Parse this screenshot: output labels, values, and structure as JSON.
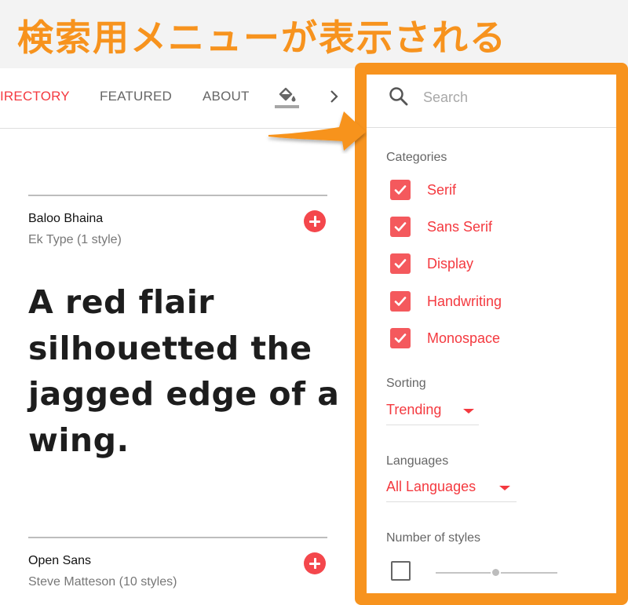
{
  "banner": {
    "title": "検索用メニューが表示される",
    "color": "#f7931e"
  },
  "nav": {
    "tabs": [
      {
        "label": "IRECTORY",
        "active": true
      },
      {
        "label": "FEATURED",
        "active": false
      },
      {
        "label": "ABOUT",
        "active": false
      }
    ],
    "icons": [
      "paint-bucket-icon",
      "chevron-right-icon"
    ]
  },
  "fonts": [
    {
      "name": "Baloo Bhaina",
      "meta": "Ek Type (1 style)",
      "sample": "A red flair silhouetted the jagged edge of a wing."
    },
    {
      "name": "Open Sans",
      "meta": "Steve Matteson (10 styles)"
    }
  ],
  "panel": {
    "search": {
      "placeholder": "Search",
      "value": ""
    },
    "categories": {
      "label": "Categories",
      "items": [
        {
          "label": "Serif",
          "checked": true
        },
        {
          "label": "Sans Serif",
          "checked": true
        },
        {
          "label": "Display",
          "checked": true
        },
        {
          "label": "Handwriting",
          "checked": true
        },
        {
          "label": "Monospace",
          "checked": true
        }
      ]
    },
    "sorting": {
      "label": "Sorting",
      "value": "Trending"
    },
    "languages": {
      "label": "Languages",
      "value": "All Languages"
    },
    "styles": {
      "label": "Number of styles",
      "checked": false,
      "slider_fraction": 0.5
    }
  },
  "colors": {
    "accent": "#f4393f",
    "checkbox": "#f4595d",
    "highlight": "#f7931e"
  }
}
